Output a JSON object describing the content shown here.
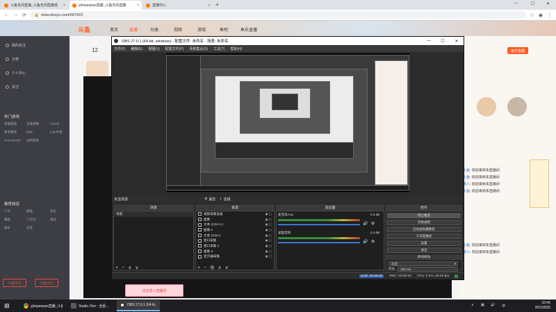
{
  "browser": {
    "tabs": [
      {
        "label": "斗鱼无间直播_斗鱼无间直播视"
      },
      {
        "label": "yjlmpanpan直播_斗鱼无间直播"
      },
      {
        "label": "直播中心"
      }
    ],
    "new_tab": "+",
    "url": "www.douyu.com/667423"
  },
  "site": {
    "logo": "斗鱼",
    "topnav": [
      "首页",
      "直播",
      "分类",
      "视频",
      "游戏",
      "鱼吧",
      "鱼乐直播"
    ],
    "sidebar_items": [
      "我的关注",
      "分类",
      "个人中心",
      "关注"
    ],
    "follow_count": "12",
    "section_hot": "热门游戏",
    "section_hot_games": [
      "英雄联盟",
      "王者荣耀",
      "CSGO",
      "和平精英",
      "DNF",
      "LOL手游",
      "VALORANT",
      "主机游戏"
    ],
    "section_rec": "推荐频道",
    "section_rec_games": [
      "户外",
      "颜值",
      "音乐",
      "舞蹈",
      "二次元",
      "电台",
      "娱乐",
      "交友"
    ],
    "side_btn_1": "斗鱼车队",
    "side_btn_2": "斗鱼大厅",
    "chat_lines": [
      {
        "user": "小鱼",
        "text": "欢迎来到本直播间"
      },
      {
        "user": "小鱼",
        "text": "欢迎来到本直播间"
      },
      {
        "user": "路人",
        "text": "欢迎来到本直播间"
      },
      {
        "user": "小鱼",
        "text": "欢迎来到本直播间"
      },
      {
        "user": "小鱼",
        "text": "欢迎来到本直播间"
      },
      {
        "user": "路人",
        "text": "欢迎来到本直播间"
      }
    ],
    "banner_tag": "鱼乐直播",
    "ad_text": "点击进入直播间"
  },
  "obs": {
    "title": "OBS 27.0.1 (64-bit, windows) - 配置文件: 未命名 - 场景: 未命名",
    "menu": [
      "文件(F)",
      "编辑(E)",
      "视图(V)",
      "配置文件(P)",
      "场景集合(S)",
      "工具(T)",
      "帮助(H)"
    ],
    "win_min": "—",
    "win_max": "☐",
    "win_close": "✕",
    "scene_label": "未选择源",
    "props_btn": "属性",
    "filters_btn": "滤镜",
    "docks": {
      "scenes": "场景",
      "sources": "来源",
      "mixer": "混音器",
      "controls": "控件"
    },
    "scenes": [
      "场景"
    ],
    "sources": [
      "视频采集设备",
      "图像",
      "文本 (GDI+) 2",
      "图像 2",
      "文本 (GDI+)",
      "窗口采集",
      "窗口采集 2",
      "图像 3",
      "显示器采集"
    ],
    "mixer": [
      {
        "name": "麦克风/Aux",
        "db": "0.0 dB"
      },
      {
        "name": "桌面音频",
        "db": "0.0 dB"
      }
    ],
    "controls": [
      "停止推流",
      "开始录制",
      "启动虚拟摄像机",
      "工作室模式",
      "设置",
      "退出"
    ],
    "transition_label": "转场特效",
    "transition_value": "淡出",
    "duration_label": "时长",
    "duration_value": "300 ms",
    "status": {
      "live": "LIVE: 00:00:00",
      "rec": "REC: 00:00:00",
      "cpu": "CPU: 0.2%, 60.00 fps"
    }
  },
  "taskbar": {
    "apps": [
      {
        "label": "yjlmpanpan直播_斗鱼..."
      },
      {
        "label": "Studio One - 全民..."
      },
      {
        "label": "OBS 27.0.1 (64-bi..."
      }
    ],
    "time": "10:45",
    "date": "2021/8/25",
    "lang": "中"
  }
}
